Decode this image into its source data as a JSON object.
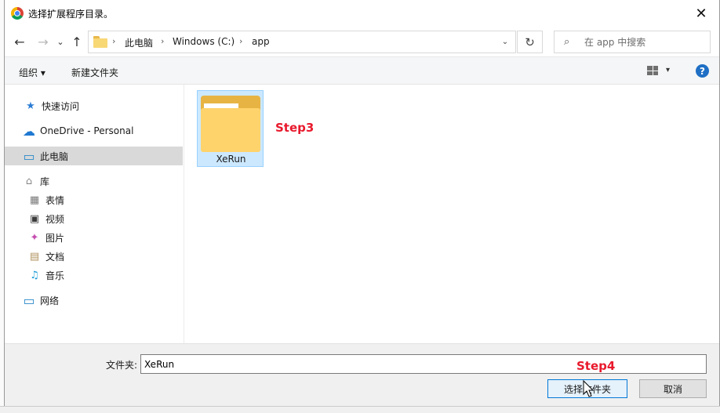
{
  "window": {
    "title": "选择扩展程序目录。",
    "close_glyph": "✕"
  },
  "nav": {
    "back_glyph": "←",
    "forward_glyph": "→",
    "recent_glyph": "⌄",
    "up_glyph": "↑",
    "breadcrumbs": [
      "此电脑",
      "Windows (C:)",
      "app"
    ],
    "separator": "›",
    "dropdown_glyph": "⌄",
    "refresh_glyph": "↻",
    "search_placeholder": "在 app 中搜索",
    "search_glyph": "⌕"
  },
  "toolbar": {
    "organize_label": "组织 ▾",
    "new_folder_label": "新建文件夹",
    "view_caret": "▾",
    "help_label": "?"
  },
  "sidebar": {
    "items": [
      {
        "label": "快速访问",
        "icon": "star-icon",
        "glyph": "★",
        "color": "#2b7cd3"
      },
      {
        "label": "OneDrive - Personal",
        "icon": "cloud-icon",
        "glyph": "☁",
        "color": "#1f78d1"
      },
      {
        "label": "此电脑",
        "icon": "computer-icon",
        "glyph": "▭",
        "color": "#2a89c9"
      },
      {
        "label": "库",
        "icon": "library-icon",
        "glyph": "⌂",
        "color": "#8a8a8a"
      },
      {
        "label": "表情",
        "icon": "emoji-grid-icon",
        "glyph": "▦",
        "color": "#7a7a7a"
      },
      {
        "label": "视频",
        "icon": "video-icon",
        "glyph": "▣",
        "color": "#3c3c3c"
      },
      {
        "label": "图片",
        "icon": "pictures-icon",
        "glyph": "✦",
        "color": "#c54fb0"
      },
      {
        "label": "文档",
        "icon": "documents-icon",
        "glyph": "▤",
        "color": "#b0925e"
      },
      {
        "label": "音乐",
        "icon": "music-icon",
        "glyph": "♫",
        "color": "#1a9bd7"
      },
      {
        "label": "网络",
        "icon": "network-icon",
        "glyph": "▭",
        "color": "#2a89c9"
      }
    ]
  },
  "content": {
    "folder_name": "XeRun"
  },
  "annotations": {
    "step3": "Step3",
    "step4": "Step4"
  },
  "footer": {
    "folder_label": "文件夹:",
    "folder_value": "XeRun",
    "select_button": "选择文件夹",
    "cancel_button": "取消"
  },
  "colors": {
    "accent": "#0078d7",
    "selection_bg": "#cce8ff",
    "annotation_red": "#e8192c"
  }
}
